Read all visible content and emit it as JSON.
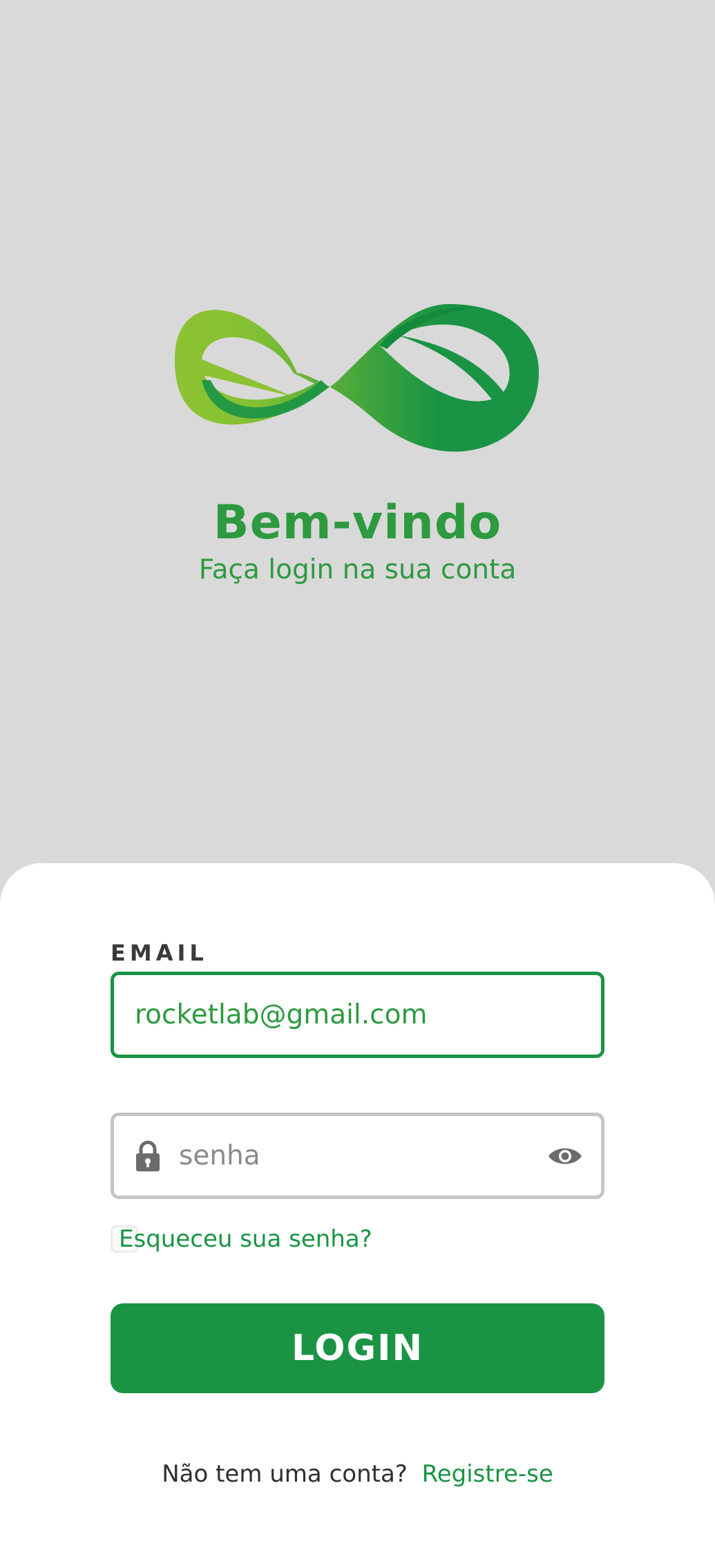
{
  "header": {
    "title": "Bem-vindo",
    "subtitle": "Faça login na sua conta"
  },
  "form": {
    "email_label": "EMAIL",
    "email_value": "rocketlab@gmail.com",
    "password_placeholder": "senha",
    "forgot_password": "Esqueceu sua senha?",
    "login_button": "LOGIN"
  },
  "footer": {
    "prompt": "Não tem uma conta?",
    "register_link": "Registre-se"
  },
  "icons": {
    "logo": "infinity-leaf-logo",
    "password_icon": "lock-icon",
    "toggle_visibility": "eye-icon"
  },
  "colors": {
    "background": "#d9d9d9",
    "card": "#ffffff",
    "primary": "#1a9444",
    "title_green": "#2e9a40",
    "logo_light": "#8cc332",
    "input_border_inactive": "#c4c4c4",
    "text_dark": "#2e2e2e"
  }
}
